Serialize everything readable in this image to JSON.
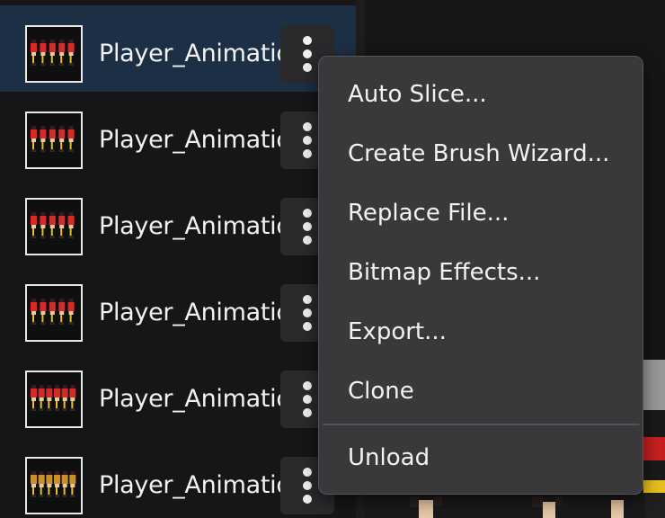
{
  "asset_list": {
    "items": [
      {
        "name": "Player_Animation",
        "selected": true,
        "thumb_palette": "red-figures"
      },
      {
        "name": "Player_Animation",
        "selected": false,
        "thumb_palette": "red-figures"
      },
      {
        "name": "Player_Animation",
        "selected": false,
        "thumb_palette": "red-figures"
      },
      {
        "name": "Player_Animation",
        "selected": false,
        "thumb_palette": "red-figures"
      },
      {
        "name": "Player_Animation",
        "selected": false,
        "thumb_palette": "red-figures"
      },
      {
        "name": "Player_Animation",
        "selected": false,
        "thumb_palette": "gold-figures"
      }
    ],
    "options_icon": "more-vertical-icon"
  },
  "context_menu": {
    "items": [
      {
        "label": "Auto Slice..."
      },
      {
        "label": "Create Brush Wizard..."
      },
      {
        "label": "Replace File..."
      },
      {
        "label": "Bitmap Effects..."
      },
      {
        "label": "Export..."
      },
      {
        "label": "Clone"
      },
      {
        "label": "Unload"
      }
    ]
  },
  "colors": {
    "panel_background": "#161618",
    "selected_row": "#1c2f45",
    "menu_background": "#39393c",
    "menu_text": "#f2f2f2",
    "kebab_button": "#2a2a2d",
    "sprite_red": "#d42a2a",
    "sprite_gold": "#c8902a"
  }
}
